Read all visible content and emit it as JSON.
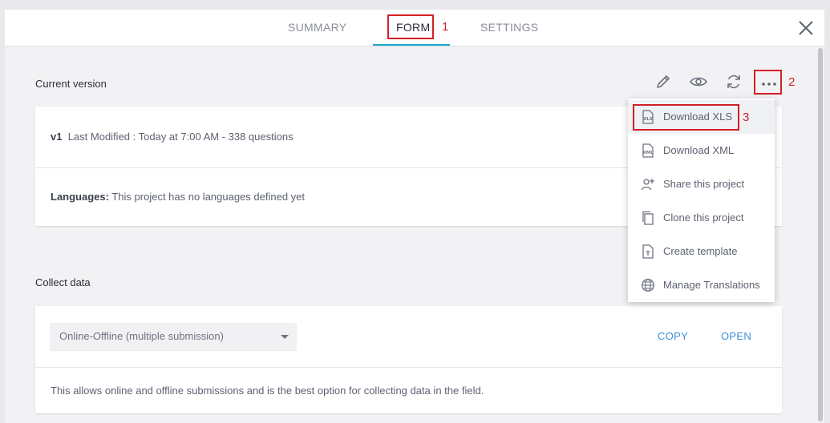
{
  "tabs": [
    {
      "label": "SUMMARY"
    },
    {
      "label": "FORM"
    },
    {
      "label": "SETTINGS"
    }
  ],
  "callouts": [
    "1",
    "2",
    "3"
  ],
  "current_version": {
    "title": "Current version",
    "version": "v1",
    "modified": "Last Modified : Today at 7:00 AM - 338 questions",
    "languages_label": "Languages:",
    "languages_text": "This project has no languages defined yet"
  },
  "toolbar_icons": [
    "pencil-icon",
    "eye-icon",
    "refresh-icon",
    "more-icon"
  ],
  "menu": {
    "items": [
      {
        "label": "Download XLS",
        "icon": "xls-file-icon"
      },
      {
        "label": "Download XML",
        "icon": "xml-file-icon"
      },
      {
        "label": "Share this project",
        "icon": "add-user-icon"
      },
      {
        "label": "Clone this project",
        "icon": "clone-icon"
      },
      {
        "label": "Create template",
        "icon": "template-icon"
      },
      {
        "label": "Manage Translations",
        "icon": "globe-icon"
      }
    ]
  },
  "collect_data": {
    "title": "Collect data",
    "select_value": "Online-Offline (multiple submission)",
    "copy_label": "COPY",
    "open_label": "OPEN",
    "description": "This allows online and offline submissions and is the best option for collecting data in the field."
  },
  "colors": {
    "accent": "#1aa6c7",
    "link": "#3a8fd6",
    "callout": "#d21f26"
  }
}
